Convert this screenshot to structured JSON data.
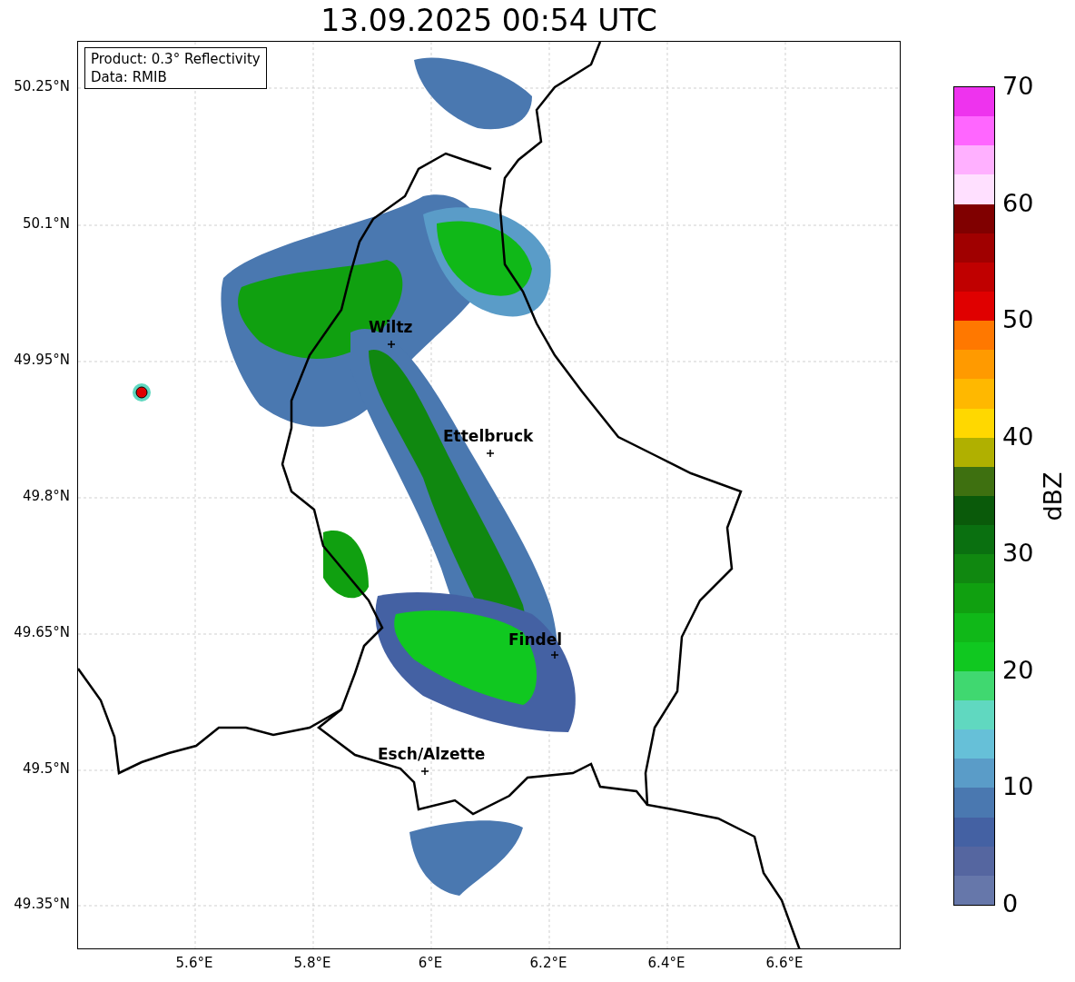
{
  "title": "13.09.2025 00:54 UTC",
  "info_box": {
    "lines": [
      "Product: 0.3° Reflectivity",
      "Data: RMIB"
    ]
  },
  "lat_ticks": [
    "50.25°N",
    "50.1°N",
    "49.95°N",
    "49.8°N",
    "49.65°N",
    "49.5°N",
    "49.35°N"
  ],
  "lon_ticks": [
    "5.6°E",
    "5.8°E",
    "6°E",
    "6.2°E",
    "6.4°E",
    "6.6°E"
  ],
  "cities": [
    {
      "name": "Wiltz"
    },
    {
      "name": "Ettelbruck"
    },
    {
      "name": "Findel"
    },
    {
      "name": "Esch/Alzette"
    }
  ],
  "colorbar": {
    "label": "dBZ",
    "ticks": [
      "70",
      "60",
      "50",
      "40",
      "30",
      "20",
      "10",
      "0"
    ],
    "bands": [
      {
        "color": "#ee33ee"
      },
      {
        "color": "#ff66ff"
      },
      {
        "color": "#ffb0ff"
      },
      {
        "color": "#ffe0ff"
      },
      {
        "color": "#800000"
      },
      {
        "color": "#a00000"
      },
      {
        "color": "#c00000"
      },
      {
        "color": "#e00000"
      },
      {
        "color": "#ff7800"
      },
      {
        "color": "#ff9a00"
      },
      {
        "color": "#ffb800"
      },
      {
        "color": "#ffd800"
      },
      {
        "color": "#b0b000"
      },
      {
        "color": "#3e7010"
      },
      {
        "color": "#0a5a0a"
      },
      {
        "color": "#0a7010"
      },
      {
        "color": "#108810"
      },
      {
        "color": "#10a010"
      },
      {
        "color": "#10b818"
      },
      {
        "color": "#10c820"
      },
      {
        "color": "#40d870"
      },
      {
        "color": "#60d8c0"
      },
      {
        "color": "#66c0d8"
      },
      {
        "color": "#5a9cc8"
      },
      {
        "color": "#4a78b0"
      },
      {
        "color": "#4461a3"
      },
      {
        "color": "#5566a0"
      },
      {
        "color": "#6677aa"
      }
    ]
  }
}
